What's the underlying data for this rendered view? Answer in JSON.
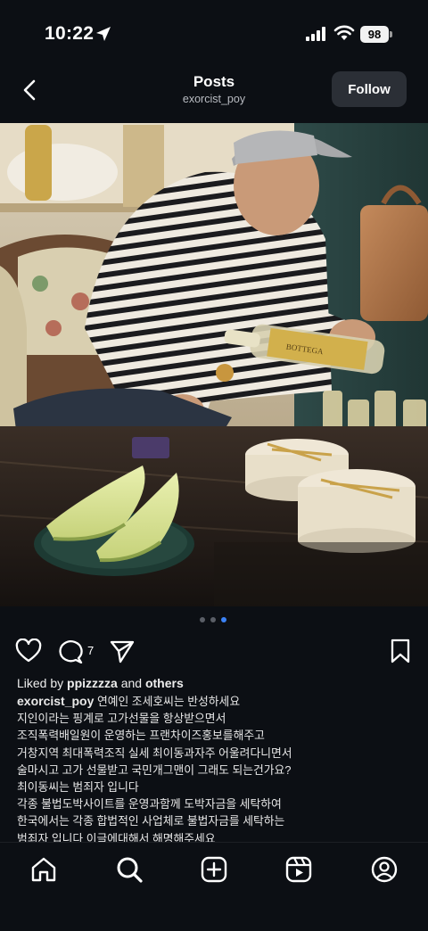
{
  "status_bar": {
    "time": "10:22",
    "battery": "98"
  },
  "header": {
    "title": "Posts",
    "username": "exorcist_poy",
    "follow_label": "Follow"
  },
  "carousel": {
    "count": 3,
    "active_index": 2
  },
  "actions": {
    "comment_count": "7"
  },
  "likes": {
    "prefix": "Liked by ",
    "user": "ppizzzza",
    "middle": " and ",
    "others": "others"
  },
  "caption": {
    "username": "exorcist_poy",
    "first_line": "연예인 조세호씨는 반성하세요",
    "lines": [
      "지인이라는 핑계로 고가선물을 항상받으면서",
      "조직폭력배일원이 운영하는 프랜차이즈홍보를해주고",
      "거창지역 최대폭력조직 실세 최이동과자주 어울려다니면서",
      "술마시고 고가 선물받고 국민개그맨이 그래도 되는건가요?",
      "최이동씨는 범죄자 입니다",
      "각종 불법도박사이트를 운영과함께 도박자금을 세탁하여",
      "한국에서는 각종 합법적인 사업체로 불법자금를 세탁하는",
      "범죄자 입니다 이글에대해서 해명해주세요"
    ]
  },
  "photo": {
    "bottle_label": "BOTTEGA"
  },
  "nav": {
    "items": [
      "home-icon",
      "search-icon",
      "create-icon",
      "reels-icon",
      "profile-icon"
    ]
  },
  "colors": {
    "background": "#0c0f14",
    "accent_dot": "#3b82f6",
    "follow_bg": "#2b2f36"
  }
}
